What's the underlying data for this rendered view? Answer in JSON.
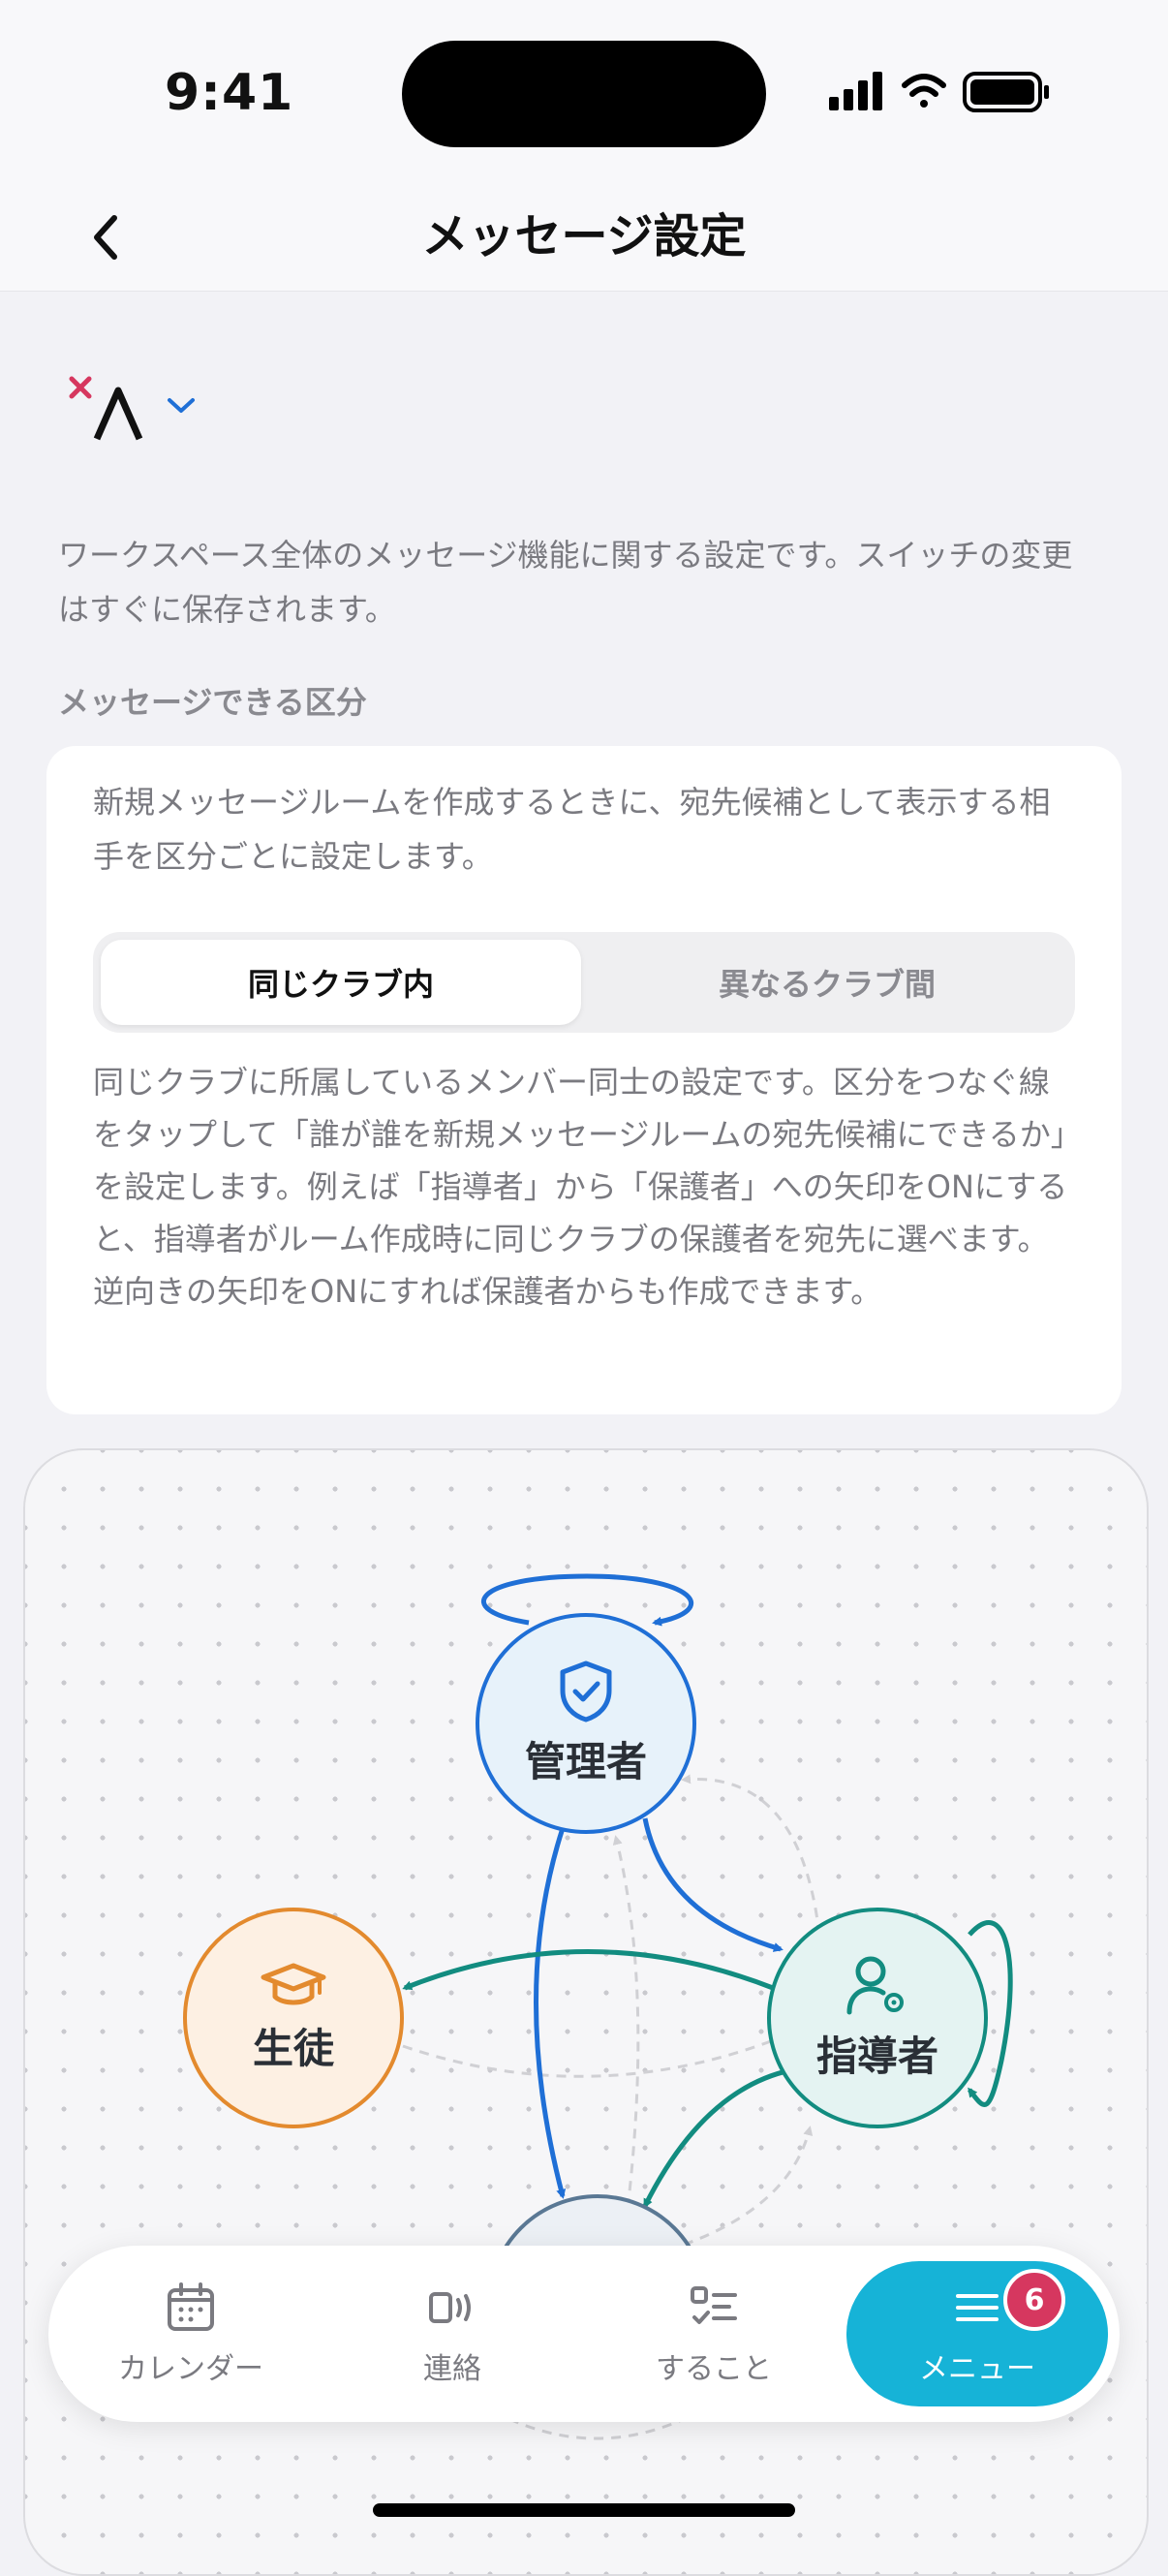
{
  "status": {
    "time": "9:41"
  },
  "nav": {
    "title": "メッセージ設定"
  },
  "workspace": {
    "logo": "×Λ"
  },
  "intro_text": "ワークスペース全体のメッセージ機能に関する設定です。スイッチの変更はすぐに保存されます。",
  "section": {
    "title": "メッセージできる区分"
  },
  "card": {
    "description": "新規メッセージルームを作成するときに、宛先候補として表示する相手を区分ごとに設定します。",
    "segments": [
      "同じクラブ内",
      "異なるクラブ間"
    ],
    "selected_segment": "同じクラブ内",
    "explanation": "同じクラブに所属しているメンバー同士の設定です。区分をつなぐ線をタップして「誰が誰を新規メッセージルームの宛先候補にできるか」を設定します。例えば「指導者」から「保護者」への矢印をONにすると、指導者がルーム作成時に同じクラブの保護者を宛先に選べます。逆向きの矢印をONにすれば保護者からも作成できます。"
  },
  "graph": {
    "nodes": {
      "admin": {
        "label": "管理者",
        "icon": "shield-check-icon",
        "color": "#1f6fd6"
      },
      "teacher": {
        "label": "指導者",
        "icon": "person-gear-icon",
        "color": "#128c80"
      },
      "student": {
        "label": "生徒",
        "icon": "graduation-cap-icon",
        "color": "#e38a2e"
      },
      "parent": {
        "icon": "person-icon",
        "color": "#5a7894"
      }
    }
  },
  "tabs": [
    {
      "label": "カレンダー",
      "icon": "calendar-icon"
    },
    {
      "label": "連絡",
      "icon": "broadcast-icon"
    },
    {
      "label": "すること",
      "icon": "checklist-icon"
    },
    {
      "label": "メニュー",
      "icon": "menu-icon",
      "badge": "6",
      "active": true
    }
  ],
  "colors": {
    "accent": "#16b3d7",
    "badge": "#d6375f"
  }
}
